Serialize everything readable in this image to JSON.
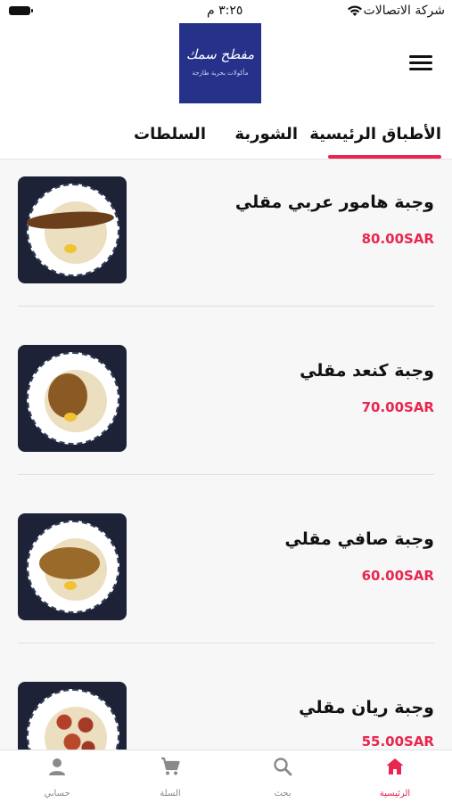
{
  "status_bar": {
    "carrier": "شركة الاتصالات",
    "time": "٣:٢٥ م"
  },
  "header": {
    "logo_text": "مفطح سمك",
    "logo_subtext": "مأكولات بحرية طازجة"
  },
  "tabs": [
    {
      "label": "الأطباق الرئيسية",
      "active": true
    },
    {
      "label": "الشوربة",
      "active": false
    },
    {
      "label": "السلطات",
      "active": false
    }
  ],
  "items": [
    {
      "name": "وجبة هامور عربي  مقلي",
      "price": "80.00SAR"
    },
    {
      "name": "وجبة كنعد مقلي",
      "price": "70.00SAR"
    },
    {
      "name": "وجبة صافي مقلي",
      "price": "60.00SAR"
    },
    {
      "name": "وجبة ريان مقلي",
      "price": "55.00SAR"
    }
  ],
  "tabbar": {
    "home": "الرئيسية",
    "search": "بحث",
    "cart": "السلة",
    "account": "حسابي"
  },
  "colors": {
    "accent": "#e8264f",
    "logo_bg": "#26318a",
    "inactive": "#8a8a8a"
  },
  "icons": [
    "wifi-icon",
    "battery-icon",
    "menu-icon",
    "home-icon",
    "search-icon",
    "cart-icon",
    "account-icon"
  ]
}
